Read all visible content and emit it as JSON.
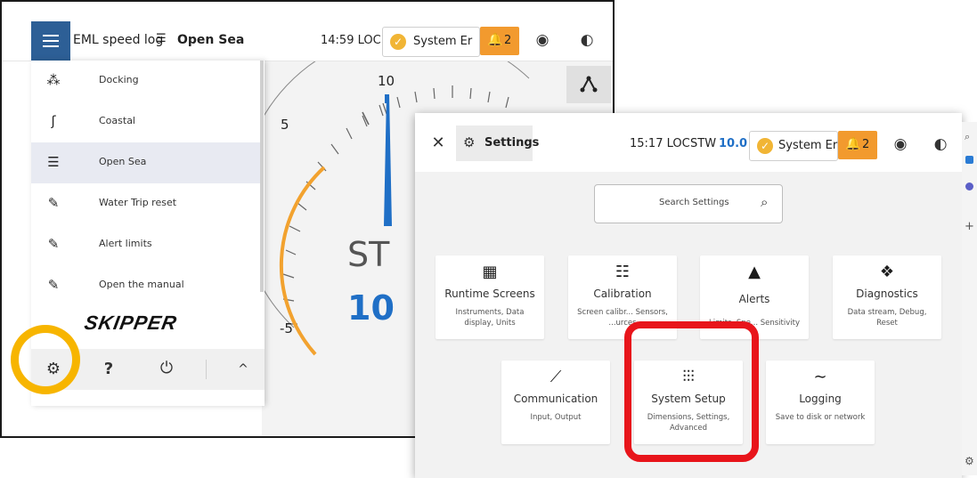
{
  "speedlog": {
    "title_prefix": "EML speed log",
    "mode_icon": "open-sea-icon",
    "mode_label": "Open Sea",
    "time": "14:59 LOC",
    "status_label": "System Er",
    "alert_count": "2",
    "drawer": {
      "items": [
        {
          "icon": "docking-icon",
          "label": "Docking"
        },
        {
          "icon": "coastal-icon",
          "label": "Coastal"
        },
        {
          "icon": "open-sea-icon",
          "label": "Open Sea",
          "selected": true
        },
        {
          "icon": "pencil-icon",
          "label": "Water Trip reset"
        },
        {
          "icon": "pencil-icon",
          "label": "Alert limits"
        },
        {
          "icon": "pencil-icon",
          "label": "Open the manual"
        }
      ],
      "brand": "SKIPPER"
    },
    "gauge": {
      "tick_labels": [
        "10",
        "5",
        "-5"
      ],
      "label": "ST",
      "value": "10"
    }
  },
  "settings": {
    "title": "Settings",
    "time": "15:17 LOC",
    "stw_label": "STW",
    "stw_value": "10.0",
    "status_label": "System Er",
    "alert_count": "2",
    "search_placeholder": "Search Settings",
    "tiles_row1": [
      {
        "icon": "runtime-screens-icon",
        "title": "Runtime Screens",
        "desc": "Instruments, Data display, Units"
      },
      {
        "icon": "calibration-icon",
        "title": "Calibration",
        "desc": "Screen calibr... Sensors, ...urces"
      },
      {
        "icon": "alerts-icon",
        "title": "Alerts",
        "desc": "Limits, Spe... Sensitivity"
      },
      {
        "icon": "diagnostics-icon",
        "title": "Diagnostics",
        "desc": "Data stream, Debug, Reset"
      }
    ],
    "tiles_row2": [
      {
        "icon": "communication-icon",
        "title": "Communication",
        "desc": "Input, Output"
      },
      {
        "icon": "system-setup-icon",
        "title": "System Setup",
        "desc": "Dimensions, Settings, Advanced"
      },
      {
        "icon": "logging-icon",
        "title": "Logging",
        "desc": "Save to disk or network"
      }
    ]
  },
  "colors": {
    "accent_blue": "#2d5f96",
    "gauge_blue": "#1f6fc6",
    "warning_orange": "#f29a2e",
    "highlight_ring": "#f7b500",
    "highlight_box": "#e8151b"
  }
}
